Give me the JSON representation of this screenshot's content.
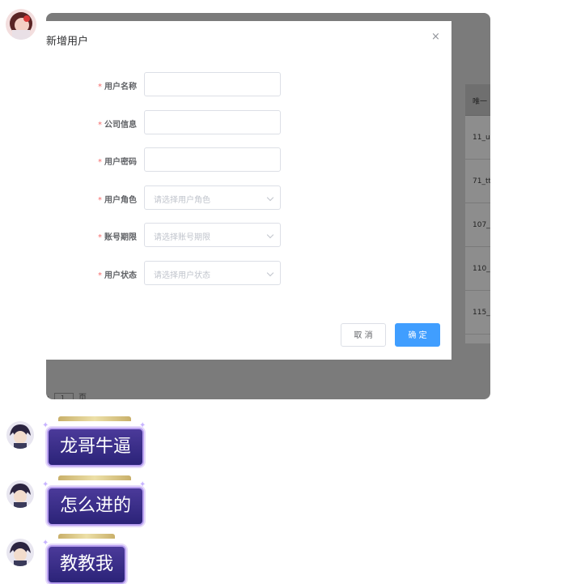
{
  "dialog": {
    "title": "新增用户",
    "close": "×",
    "fields": [
      {
        "label": "用户名称",
        "required": "*",
        "type": "input",
        "value": ""
      },
      {
        "label": "公司信息",
        "required": "*",
        "type": "input",
        "value": ""
      },
      {
        "label": "用户密码",
        "required": "*",
        "type": "input",
        "value": ""
      },
      {
        "label": "用户角色",
        "required": "*",
        "type": "select",
        "placeholder": "请选择用户角色"
      },
      {
        "label": "账号期限",
        "required": "*",
        "type": "select",
        "placeholder": "请选择账号期限"
      },
      {
        "label": "用户状态",
        "required": "*",
        "type": "select",
        "placeholder": "请选择用户状态"
      }
    ],
    "cancel_label": "取 消",
    "ok_label": "确 定"
  },
  "background_table": {
    "header": "唯一",
    "rows": [
      "11_u",
      "71_tt",
      "107_",
      "110_",
      "115_"
    ]
  },
  "background_pager": {
    "prefix": "1",
    "suffix": "页"
  },
  "messages": [
    {
      "text": "龙哥牛逼"
    },
    {
      "text": "怎么进的"
    },
    {
      "text": "教教我"
    }
  ],
  "colors": {
    "primary": "#409eff",
    "required": "#f56c6c",
    "bubble": "#3a2f8a",
    "overlay": "#7b7b7b"
  }
}
